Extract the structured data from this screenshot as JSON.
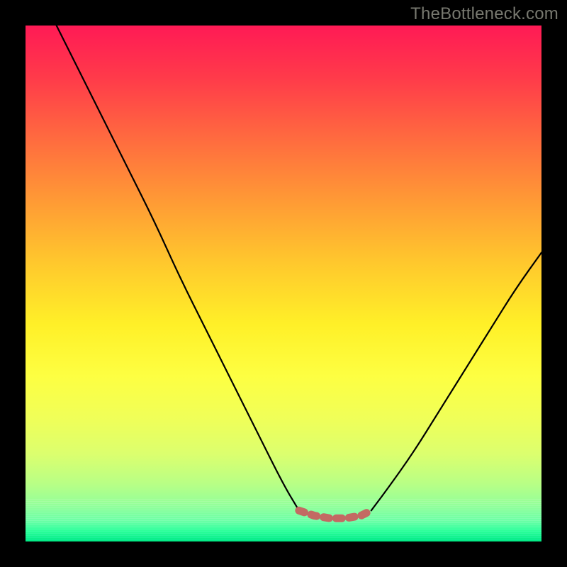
{
  "watermark": "TheBottleneck.com",
  "colors": {
    "background_black": "#000000",
    "gradient_top": "#ff1a55",
    "gradient_bottom": "#00e884",
    "curve_stroke": "#000000",
    "valley_stroke": "#c36a63"
  },
  "chart_data": {
    "type": "line",
    "title": "",
    "xlabel": "",
    "ylabel": "",
    "xlim": [
      0,
      100
    ],
    "ylim": [
      0,
      100
    ],
    "series": [
      {
        "name": "left-curve",
        "x": [
          6,
          10,
          15,
          20,
          25,
          30,
          35,
          40,
          45,
          50,
          53
        ],
        "values": [
          100,
          92,
          82,
          72,
          62,
          51,
          41,
          31,
          21,
          11,
          6
        ]
      },
      {
        "name": "right-curve",
        "x": [
          67,
          70,
          75,
          80,
          85,
          90,
          95,
          100
        ],
        "values": [
          6,
          10,
          17,
          25,
          33,
          41,
          49,
          56
        ]
      },
      {
        "name": "valley-flat",
        "x": [
          53,
          56,
          59,
          62,
          65,
          67
        ],
        "values": [
          6,
          5,
          4.5,
          4.5,
          5,
          6
        ]
      }
    ],
    "annotations": []
  }
}
